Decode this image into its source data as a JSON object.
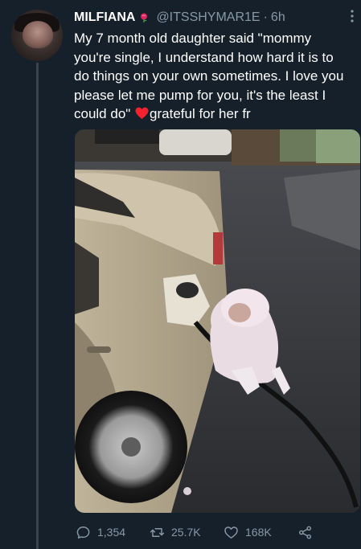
{
  "tweet": {
    "display_name": "MILFIANA",
    "handle": "@ITSSHYMAR1E",
    "separator": "·",
    "time": "6h",
    "text_before_emoji": "My 7 month old daughter said \"mommy you're single, I understand how hard it is to do things on your own sometimes. I love you please let me pump for you, it's the least I could do\" ",
    "text_after_emoji": "grateful for her fr",
    "emoji": "red-heart-icon",
    "name_badge_icon": "rose-badge-icon",
    "more_icon": "more-vertical-icon"
  },
  "media": {
    "description_icon": "photo"
  },
  "actions": {
    "replies": "1,354",
    "retweets": "25.7K",
    "likes": "168K",
    "reply_icon": "reply-icon",
    "retweet_icon": "retweet-icon",
    "like_icon": "heart-outline-icon",
    "share_icon": "share-icon"
  },
  "colors": {
    "background": "#15202b",
    "secondary_text": "#8899a6",
    "heart": "#f4212e"
  }
}
